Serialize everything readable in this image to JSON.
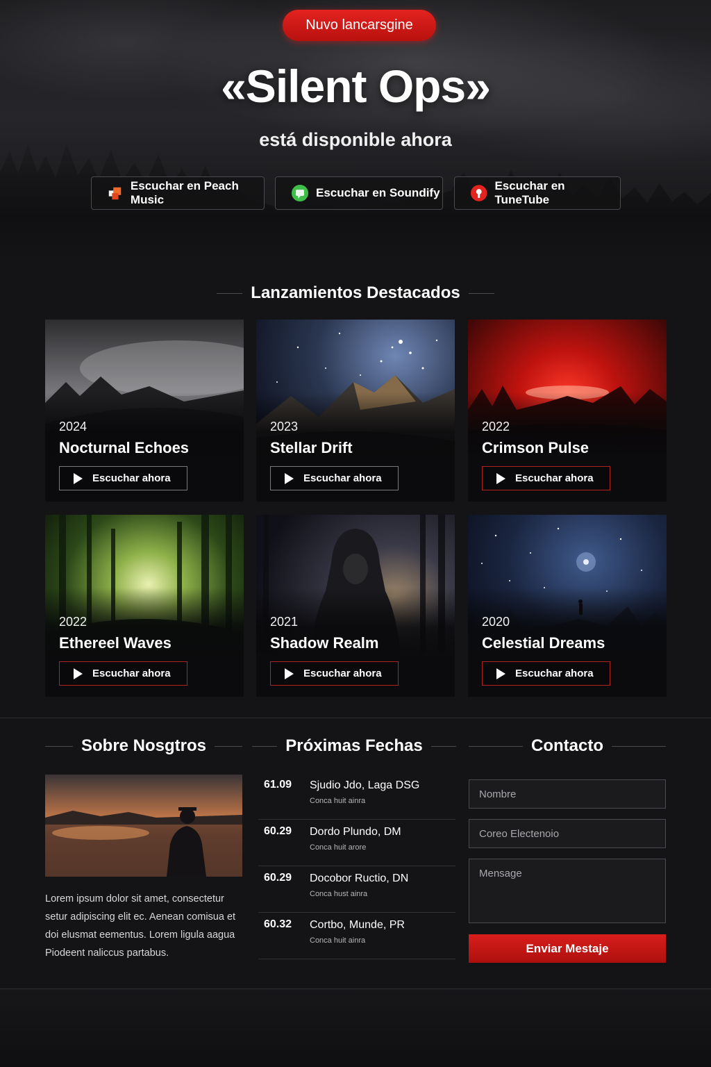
{
  "hero": {
    "badge": "Nuvo lancarsgine",
    "title": "«Silent Ops»",
    "subtitle": "está disponible ahora",
    "stream_buttons": [
      {
        "label": "Escuchar en Peach Music",
        "icon": "peach-music-icon",
        "color": "#f06a2a"
      },
      {
        "label": "Escuchar en Soundify",
        "icon": "soundify-icon",
        "color": "#3fbf4a"
      },
      {
        "label": "Escuchar en TuneTube",
        "icon": "tunetube-icon",
        "color": "#e3231f"
      }
    ]
  },
  "releases": {
    "heading": "Lanzamientos Destacados",
    "items": [
      {
        "year": "2024",
        "title": "Nocturnal Echoes",
        "cta": "Escuchar ahora",
        "theme": "foggy-forest"
      },
      {
        "year": "2023",
        "title": "Stellar Drift",
        "cta": "Escuchar ahora",
        "theme": "starry-mountains"
      },
      {
        "year": "2022",
        "title": "Crimson Pulse",
        "cta": "Escuchar ahora",
        "theme": "red-sky"
      },
      {
        "year": "2022",
        "title": "Ethereel Waves",
        "cta": "Escuchar ahora",
        "theme": "green-forest"
      },
      {
        "year": "2021",
        "title": "Shadow Realm",
        "cta": "Escuchar ahora",
        "theme": "hooded-figure"
      },
      {
        "year": "2020",
        "title": "Celestial Dreams",
        "cta": "Escuchar ahora",
        "theme": "night-sky"
      }
    ]
  },
  "about": {
    "heading": "Sobre Nosgtros",
    "text": "Lorem ipsum dolor sit amet, consectetur setur adipiscing elit ec. Aenean comisua et doi elusmat eementus. Lorem ligula aagua Piodeent naliccus partabus."
  },
  "dates": {
    "heading": "Próximas Fechas",
    "items": [
      {
        "date": "61.09",
        "location": "Sjudio Jdo, Laga DSG",
        "cta": "Conca huit ainra"
      },
      {
        "date": "60.29",
        "location": "Dordo Plundo, DM",
        "cta": "Conca huit arore"
      },
      {
        "date": "60.29",
        "location": "Docobor Ructio, DN",
        "cta": "Conca hust ainra"
      },
      {
        "date": "60.32",
        "location": "Cortbo, Munde, PR",
        "cta": "Conca huit ainra"
      }
    ]
  },
  "contact": {
    "heading": "Contacto",
    "name_placeholder": "Nombre",
    "email_placeholder": "Coreo Electenoio",
    "message_placeholder": "Mensage",
    "submit_label": "Enviar Mestaje"
  },
  "colors": {
    "accent": "#d81e1b",
    "background": "#141416"
  }
}
